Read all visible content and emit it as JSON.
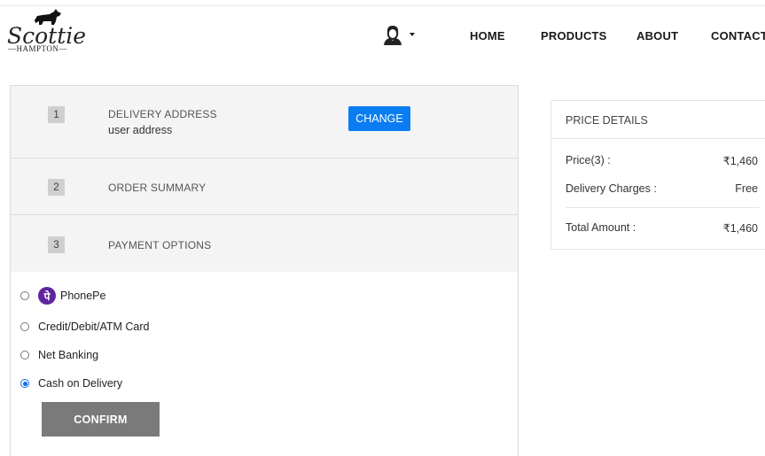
{
  "brand": {
    "script": "Scottie",
    "sub": "—HAMPTON—"
  },
  "nav": {
    "home": "HOME",
    "products": "PRODUCTS",
    "about": "ABOUT",
    "contact": "CONTACT"
  },
  "steps": [
    {
      "num": "1",
      "label": "DELIVERY ADDRESS",
      "sub": "user address",
      "button": "CHANGE"
    },
    {
      "num": "2",
      "label": "ORDER SUMMARY"
    },
    {
      "num": "3",
      "label": "PAYMENT OPTIONS"
    }
  ],
  "payment": {
    "options": [
      {
        "label": "PhonePe",
        "icon": "phonepe-logo",
        "glyph": "पे",
        "checked": false
      },
      {
        "label": "Credit/Debit/ATM Card",
        "checked": false
      },
      {
        "label": "Net Banking",
        "checked": false
      },
      {
        "label": "Cash on Delivery",
        "checked": true
      }
    ],
    "confirm": "CONFIRM"
  },
  "price": {
    "title": "PRICE DETAILS",
    "rows": [
      {
        "label": "Price(3) :",
        "value": "₹1,460"
      },
      {
        "label": "Delivery Charges :",
        "value": "Free"
      },
      {
        "label": "Total Amount :",
        "value": "₹1,460"
      }
    ]
  },
  "colors": {
    "accent": "#0b7df2",
    "confirm": "#7a7a7a",
    "phonepe": "#5f259f",
    "card_bg": "#f4f4f4"
  },
  "icons": {
    "user": "user-avatar-icon",
    "caret": "caret-down-icon",
    "logo": "scottie-dog-icon"
  }
}
